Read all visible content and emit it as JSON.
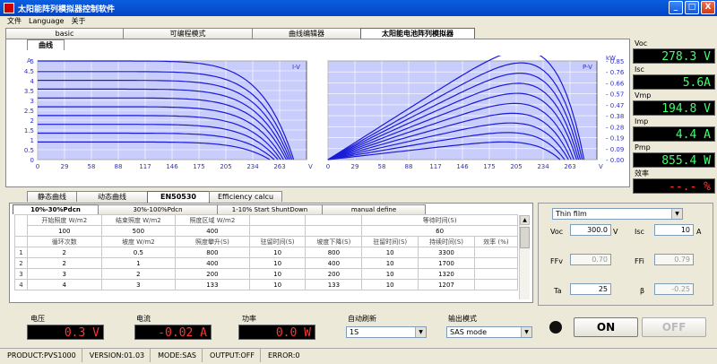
{
  "window": {
    "title": "太阳能阵列模拟器控制软件",
    "min": "_",
    "max": "□",
    "close": "X"
  },
  "menu": [
    "文件",
    "Language",
    "关于"
  ],
  "main_tabs": [
    "basic",
    "可编程模式",
    "曲线编辑器",
    "太阳能电池阵列模拟器"
  ],
  "subtab": "曲线",
  "charts": {
    "iv": {
      "unit_y": "A",
      "unit_x": "V",
      "tag": "I-V",
      "yticks": [
        "5",
        "4.5",
        "4",
        "3.5",
        "3",
        "2.5",
        "2",
        "1.5",
        "1",
        "0.5",
        "0"
      ],
      "xticks": [
        "0",
        "29",
        "58",
        "88",
        "117",
        "146",
        "175",
        "205",
        "234",
        "263"
      ]
    },
    "pv": {
      "unit_y": "kW",
      "unit_x": "V",
      "tag": "P-V",
      "yticks": [
        "0.85",
        "0.76",
        "0.66",
        "0.57",
        "0.47",
        "0.38",
        "0.28",
        "0.19",
        "0.09",
        "0.00"
      ],
      "xticks": [
        "0",
        "29",
        "58",
        "88",
        "117",
        "146",
        "175",
        "205",
        "234",
        "263"
      ]
    }
  },
  "chart_data": [
    {
      "type": "line",
      "title": "I-V",
      "xlabel": "V",
      "ylabel": "A",
      "xlim": [
        0,
        292
      ],
      "ylim": [
        0,
        5
      ],
      "series": [
        {
          "isc": 5.6,
          "voc": 278
        },
        {
          "isc": 5.0,
          "voc": 276
        },
        {
          "isc": 4.5,
          "voc": 274
        },
        {
          "isc": 4.0,
          "voc": 272
        },
        {
          "isc": 3.5,
          "voc": 270
        },
        {
          "isc": 3.0,
          "voc": 267
        },
        {
          "isc": 2.5,
          "voc": 264
        },
        {
          "isc": 2.0,
          "voc": 261
        },
        {
          "isc": 1.5,
          "voc": 257
        },
        {
          "isc": 1.0,
          "voc": 252
        }
      ]
    },
    {
      "type": "line",
      "title": "P-V",
      "xlabel": "V",
      "ylabel": "kW",
      "xlim": [
        0,
        292
      ],
      "ylim": [
        0,
        0.95
      ],
      "series_peaks_kw": [
        0.855,
        0.77,
        0.69,
        0.61,
        0.53,
        0.45,
        0.37,
        0.3,
        0.22,
        0.15
      ]
    }
  ],
  "readouts": [
    {
      "label": "Voc",
      "value": "278.3 V"
    },
    {
      "label": "Isc",
      "value": "5.6A"
    },
    {
      "label": "Vmp",
      "value": "194.8 V"
    },
    {
      "label": "Imp",
      "value": "4.4 A"
    },
    {
      "label": "Pmp",
      "value": "855.4 W"
    },
    {
      "label": "效率",
      "value": "--.- %"
    }
  ],
  "bottom_tabs": [
    "静态曲线",
    "动态曲线",
    "EN50530",
    "Efficiency calcu"
  ],
  "table_tabs": [
    "10%-30%Pdcn",
    "30%-100%Pdcn",
    "1-10% Start ShuntDown",
    "manual define"
  ],
  "table": {
    "h1": [
      "开始照度\nW/m2",
      "结束照度\nW/m2",
      "照度区域\nW/m2",
      "",
      "",
      "等待时间(S)"
    ],
    "h1_values": [
      "100",
      "500",
      "400",
      "",
      "",
      "60"
    ],
    "h2": [
      "循环次数",
      "坡度 W/m2",
      "照度攀升(S)",
      "驻留时间(S)",
      "坡度下降(S)",
      "驻留时间(S)",
      "持续时间(S)",
      "效率 (%)"
    ],
    "rows": [
      [
        "1",
        "2",
        "0.5",
        "800",
        "10",
        "800",
        "10",
        "3300",
        ""
      ],
      [
        "2",
        "2",
        "1",
        "400",
        "10",
        "400",
        "10",
        "1700",
        ""
      ],
      [
        "3",
        "3",
        "2",
        "200",
        "10",
        "200",
        "10",
        "1320",
        ""
      ],
      [
        "4",
        "4",
        "3",
        "133",
        "10",
        "133",
        "10",
        "1207",
        ""
      ]
    ]
  },
  "params": {
    "cell_type": "Thin film",
    "voc_label": "Voc",
    "voc": "300.0",
    "voc_unit": "V",
    "isc_label": "Isc",
    "isc": "10",
    "isc_unit": "A",
    "ffv_label": "FFv",
    "ffv": "0.70",
    "ffi_label": "FFi",
    "ffi": "0.79",
    "ta_label": "Ta",
    "ta": "25",
    "beta_label": "β",
    "beta": "-0.25"
  },
  "status": {
    "voltage_label": "电压",
    "voltage": "0.3 V",
    "current_label": "电流",
    "current": "-0.02 A",
    "power_label": "功率",
    "power": "0.0 W",
    "refresh_label": "自动刷新",
    "refresh": "1S",
    "output_mode_label": "输出模式",
    "output_mode": "SAS mode",
    "on": "ON",
    "off": "OFF"
  },
  "statusbar": [
    "PRODUCT:PVS1000",
    "VERSION:01.03",
    "MODE:SAS",
    "OUTPUT:OFF",
    "ERROR:0"
  ]
}
